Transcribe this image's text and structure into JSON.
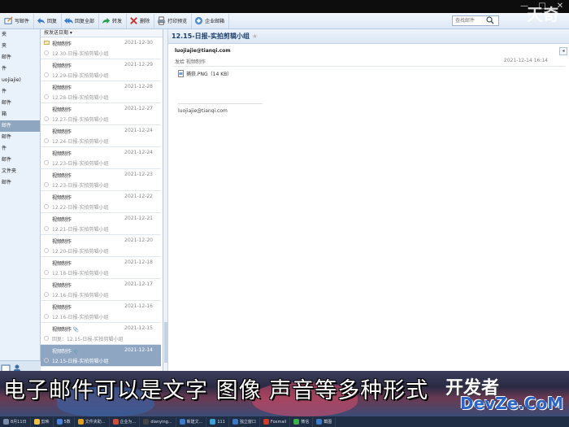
{
  "window": {
    "controls": [
      "—",
      "□",
      "✕"
    ]
  },
  "toolbar": {
    "buttons": [
      {
        "label": "写邮件",
        "icon": "compose-icon"
      },
      {
        "label": "回复",
        "icon": "reply-icon"
      },
      {
        "label": "回复全部",
        "icon": "reply-all-icon"
      },
      {
        "label": "转发",
        "icon": "forward-icon"
      },
      {
        "label": "删除",
        "icon": "delete-icon"
      },
      {
        "label": "打印预览",
        "icon": "print-icon"
      },
      {
        "label": "企业邮箱",
        "icon": "enterprise-mail-icon"
      }
    ],
    "search_placeholder": "查找邮件"
  },
  "sidebar": {
    "items": [
      {
        "label": "夹"
      },
      {
        "label": "夹"
      },
      {
        "label": "邮件"
      },
      {
        "label": "件"
      },
      {
        "label": "uojiajie)"
      },
      {
        "label": "件"
      },
      {
        "label": "邮件"
      },
      {
        "label": "箱"
      },
      {
        "label": "邮件",
        "selected": true
      },
      {
        "label": "邮件"
      },
      {
        "label": "件"
      },
      {
        "label": "邮件"
      },
      {
        "label": "文件夹"
      },
      {
        "label": "邮件"
      }
    ]
  },
  "list": {
    "sort_label": "按发送日期 ▾",
    "rows": [
      {
        "sender": "视频制作",
        "date": "2021-12-30",
        "subject": "12.30-日报-实拍剪辑小组",
        "unread": true
      },
      {
        "sender": "视频制作",
        "date": "2021-12-29",
        "subject": "12.29-日报-实拍剪辑小组"
      },
      {
        "sender": "视频制作",
        "date": "2021-12-28",
        "subject": "12.28-日报-实拍剪辑小组"
      },
      {
        "sender": "视频制作",
        "date": "2021-12-27",
        "subject": "12.27-日报-实拍剪辑小组"
      },
      {
        "sender": "视频制作",
        "date": "2021-12-24",
        "subject": "12.24-日报-实拍剪辑小组"
      },
      {
        "sender": "视频制作",
        "date": "2021-12-24",
        "subject": "12.23-日报-实拍剪辑小组"
      },
      {
        "sender": "视频制作",
        "date": "2021-12-23",
        "subject": "12.23-日报-实拍剪辑小组"
      },
      {
        "sender": "视频制作",
        "date": "2021-12-22",
        "subject": "12.22-日报-实拍剪辑小组"
      },
      {
        "sender": "视频制作",
        "date": "2021-12-21",
        "subject": "12.21-日报-实拍剪辑小组"
      },
      {
        "sender": "视频制作",
        "date": "2021-12-20",
        "subject": "12.20-日报-实拍剪辑小组"
      },
      {
        "sender": "视频制作",
        "date": "2021-12-18",
        "subject": "12.18-日报-实拍剪辑小组"
      },
      {
        "sender": "视频制作",
        "date": "2021-12-17",
        "subject": "12.16-日报-实拍剪辑小组"
      },
      {
        "sender": "视频制作",
        "date": "2021-12-16",
        "subject": "12.16-日报-实拍剪辑小组"
      },
      {
        "sender": "视频制作 📎",
        "date": "2021-12-15",
        "subject": "回复：12.15-日报-实拍剪辑小组"
      },
      {
        "sender": "视频制作 📎",
        "date": "2021-12-14",
        "subject": "12.15-日报-实拍剪辑小组",
        "selected": true
      }
    ]
  },
  "reading": {
    "subject": "12.15-日报-实拍剪辑小组",
    "from": "luojiajie@tianqi.com",
    "to": "发给 视频制作",
    "sent_time": "2021-12-14 16:14",
    "attachment": "捕获.PNG（14 KB）",
    "signature": "luojiajie@tianqi.com"
  },
  "overlay": {
    "caption": "电子邮件可以是文字 图像 声音等多种形式",
    "watermark_top": "天奇",
    "watermark_bottom_1": "开发者",
    "watermark_bottom_2": "DevZe.CoM"
  },
  "taskbar": {
    "items": [
      {
        "label": "8月11日",
        "color": "#7a8ba8"
      },
      {
        "label": "剪映",
        "color": "#f0c040"
      },
      {
        "label": "5数",
        "color": "#4a7fd8"
      },
      {
        "label": "文件夹助...",
        "color": "#e0a020"
      },
      {
        "label": "企业为...",
        "color": "#d04a3a"
      },
      {
        "label": "dianying...",
        "color": "#444"
      },
      {
        "label": "新建文...",
        "color": "#3a78c8"
      },
      {
        "label": "111",
        "color": "#3aa0d8"
      },
      {
        "label": "独立窗口",
        "color": "#3a78c8"
      },
      {
        "label": "Foxmail",
        "color": "#d03a2a"
      },
      {
        "label": "微信",
        "color": "#3ab04a"
      },
      {
        "label": "截图",
        "color": "#3a78c8"
      }
    ]
  }
}
